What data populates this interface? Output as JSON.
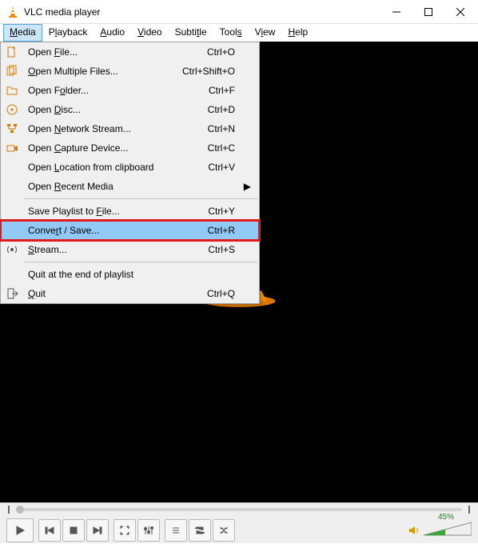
{
  "title": "VLC media player",
  "menubar": {
    "media": {
      "pre": "",
      "accel": "M",
      "post": "edia"
    },
    "playback": {
      "pre": "P",
      "accel": "l",
      "post": "ayback"
    },
    "audio": {
      "pre": "",
      "accel": "A",
      "post": "udio"
    },
    "video": {
      "pre": "",
      "accel": "V",
      "post": "ideo"
    },
    "subtitle": {
      "pre": "Subti",
      "accel": "t",
      "post": "le"
    },
    "tools": {
      "pre": "Tool",
      "accel": "s",
      "post": ""
    },
    "view": {
      "pre": "V",
      "accel": "i",
      "post": "ew"
    },
    "help": {
      "pre": "",
      "accel": "H",
      "post": "elp"
    }
  },
  "media_menu": {
    "open_file": {
      "pre": "Open ",
      "accel": "F",
      "post": "ile...",
      "shortcut": "Ctrl+O",
      "icon": "file"
    },
    "open_multiple": {
      "pre": "",
      "accel": "O",
      "post": "pen Multiple Files...",
      "shortcut": "Ctrl+Shift+O",
      "icon": "files"
    },
    "open_folder": {
      "pre": "Open F",
      "accel": "o",
      "post": "lder...",
      "shortcut": "Ctrl+F",
      "icon": "folder"
    },
    "open_disc": {
      "pre": "Open ",
      "accel": "D",
      "post": "isc...",
      "shortcut": "Ctrl+D",
      "icon": "disc"
    },
    "open_network": {
      "pre": "Open ",
      "accel": "N",
      "post": "etwork Stream...",
      "shortcut": "Ctrl+N",
      "icon": "network"
    },
    "open_capture": {
      "pre": "Open ",
      "accel": "C",
      "post": "apture Device...",
      "shortcut": "Ctrl+C",
      "icon": "capture"
    },
    "open_clipboard": {
      "pre": "Open ",
      "accel": "L",
      "post": "ocation from clipboard",
      "shortcut": "Ctrl+V",
      "icon": ""
    },
    "open_recent": {
      "pre": "Open ",
      "accel": "R",
      "post": "ecent Media",
      "shortcut": "",
      "icon": "",
      "submenu": true
    },
    "save_playlist": {
      "pre": "Save Playlist to ",
      "accel": "F",
      "post": "ile...",
      "shortcut": "Ctrl+Y",
      "icon": ""
    },
    "convert": {
      "pre": "Conve",
      "accel": "r",
      "post": "t / Save...",
      "shortcut": "Ctrl+R",
      "icon": ""
    },
    "stream": {
      "pre": "",
      "accel": "S",
      "post": "tream...",
      "shortcut": "Ctrl+S",
      "icon": "stream"
    },
    "quit_end": {
      "pre": "Quit at the end of playlist",
      "accel": "",
      "post": "",
      "shortcut": "",
      "icon": ""
    },
    "quit": {
      "pre": "",
      "accel": "Q",
      "post": "uit",
      "shortcut": "Ctrl+Q",
      "icon": "quit"
    }
  },
  "volume": {
    "percent_label": "45%",
    "percent": 45
  }
}
